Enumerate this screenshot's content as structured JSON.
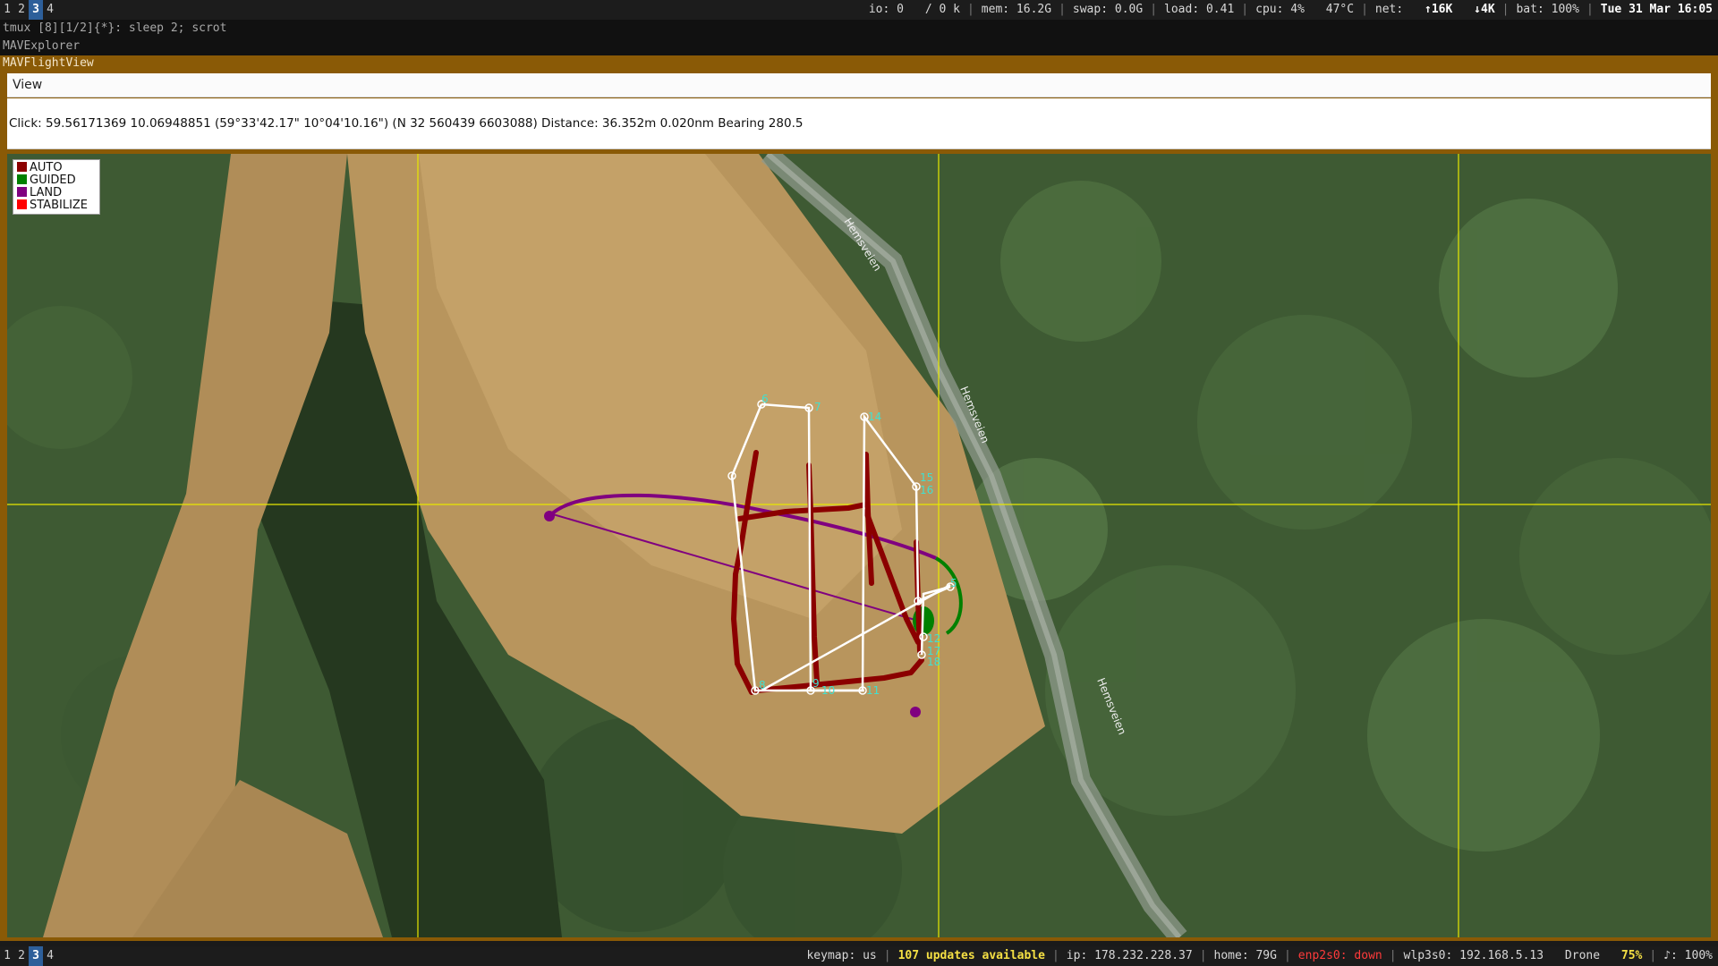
{
  "top_bar": {
    "workspaces": [
      "1",
      "2",
      "3",
      "4"
    ],
    "active_workspace": "3",
    "io": "io: 0",
    "io_rate": "/    0 k",
    "mem": "mem: 16.2G",
    "swap": "swap: 0.0G",
    "load": "load: 0.41",
    "cpu": "cpu:   4%",
    "temp": "47°C",
    "net_label": "net:",
    "net_up": "↑16K",
    "net_down": "↓4K",
    "bat": "bat: 100%",
    "datetime": "Tue 31 Mar 16:05"
  },
  "tmux_line": "tmux [8][1/2]{*}:  sleep 2; scrot",
  "explorer_line": "MAVExplorer",
  "window": {
    "title": "MAVFlightView",
    "menu": {
      "view_label": "View"
    },
    "info": "Click: 59.56171369 10.06948851 (59°33'42.17\" 10°04'10.16\") (N 32 560439 6603088)  Distance: 36.352m 0.020nm Bearing 280.5"
  },
  "legend": [
    {
      "label": "AUTO",
      "color": "#8b0000"
    },
    {
      "label": "GUIDED",
      "color": "#008000"
    },
    {
      "label": "LAND",
      "color": "#800080"
    },
    {
      "label": "STABILIZE",
      "color": "#ff0000"
    }
  ],
  "map": {
    "road_label": "Hemsveien",
    "waypoint_labels": [
      "6",
      "7",
      "14",
      "15",
      "16",
      "8",
      "9",
      "10",
      "11",
      "12",
      "17",
      "18",
      "5"
    ],
    "colors": {
      "grid": "#e8e800",
      "mission": "#ffffff",
      "waypoint_text": "#40e0d0"
    }
  },
  "bottom_bar": {
    "workspaces": [
      "1",
      "2",
      "3",
      "4"
    ],
    "active_workspace": "3",
    "keymap": "keymap: us",
    "updates": "107 updates available",
    "ip": "ip: 178.232.228.37",
    "home": "home: 79G",
    "enp": "enp2s0: down",
    "wlp": "wlp3s0: 192.168.5.13",
    "ssid": "Drone",
    "signal": "75%",
    "volume": "♪: 100%"
  }
}
